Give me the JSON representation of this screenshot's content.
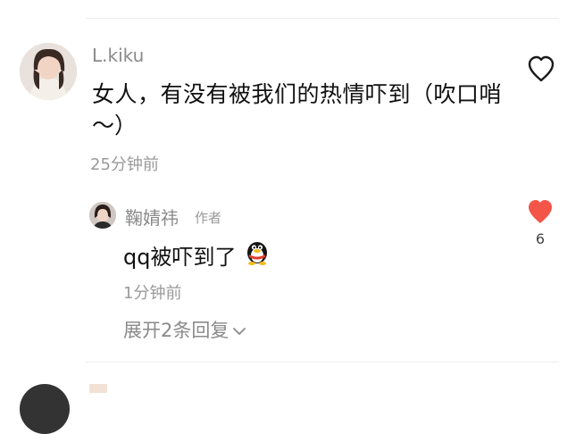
{
  "comment": {
    "username": "L.kiku",
    "text_line1": "女人，有没有被我们的热情吓到（吹口哨",
    "text_line2": "～）",
    "time": "25分钟前"
  },
  "reply": {
    "username": "鞠婧祎",
    "author_tag": "作者",
    "text": "qq被吓到了",
    "emoji": "qq-penguin-emoji",
    "time": "1分钟前",
    "like_count": "6",
    "like_color": "#f35548"
  },
  "expand_label": "展开2条回复"
}
